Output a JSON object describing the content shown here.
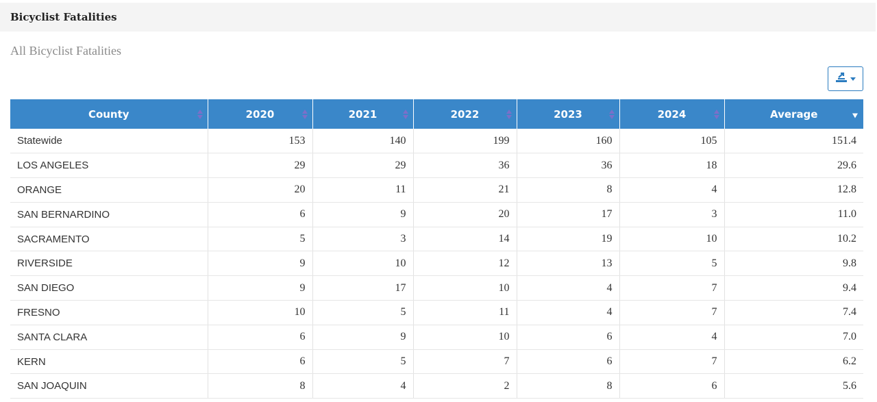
{
  "panel": {
    "title": "Bicyclist Fatalities"
  },
  "subtitle": "All Bicyclist Fatalities",
  "export": {
    "icon": "export-download-icon",
    "color": "#2a7bbf"
  },
  "table": {
    "header_color": "#3a87c9",
    "sort_icon_color": "#7b6fc9",
    "columns": [
      "County",
      "2020",
      "2021",
      "2022",
      "2023",
      "2024",
      "Average"
    ],
    "sorted_column": "Average",
    "sort_direction": "descending",
    "rows": [
      [
        "Statewide",
        "153",
        "140",
        "199",
        "160",
        "105",
        "151.4"
      ],
      [
        "LOS ANGELES",
        "29",
        "29",
        "36",
        "36",
        "18",
        "29.6"
      ],
      [
        "ORANGE",
        "20",
        "11",
        "21",
        "8",
        "4",
        "12.8"
      ],
      [
        "SAN BERNARDINO",
        "6",
        "9",
        "20",
        "17",
        "3",
        "11.0"
      ],
      [
        "SACRAMENTO",
        "5",
        "3",
        "14",
        "19",
        "10",
        "10.2"
      ],
      [
        "RIVERSIDE",
        "9",
        "10",
        "12",
        "13",
        "5",
        "9.8"
      ],
      [
        "SAN DIEGO",
        "9",
        "17",
        "10",
        "4",
        "7",
        "9.4"
      ],
      [
        "FRESNO",
        "10",
        "5",
        "11",
        "4",
        "7",
        "7.4"
      ],
      [
        "SANTA CLARA",
        "6",
        "9",
        "10",
        "6",
        "4",
        "7.0"
      ],
      [
        "KERN",
        "6",
        "5",
        "7",
        "6",
        "7",
        "6.2"
      ],
      [
        "SAN JOAQUIN",
        "8",
        "4",
        "2",
        "8",
        "6",
        "5.6"
      ]
    ]
  }
}
